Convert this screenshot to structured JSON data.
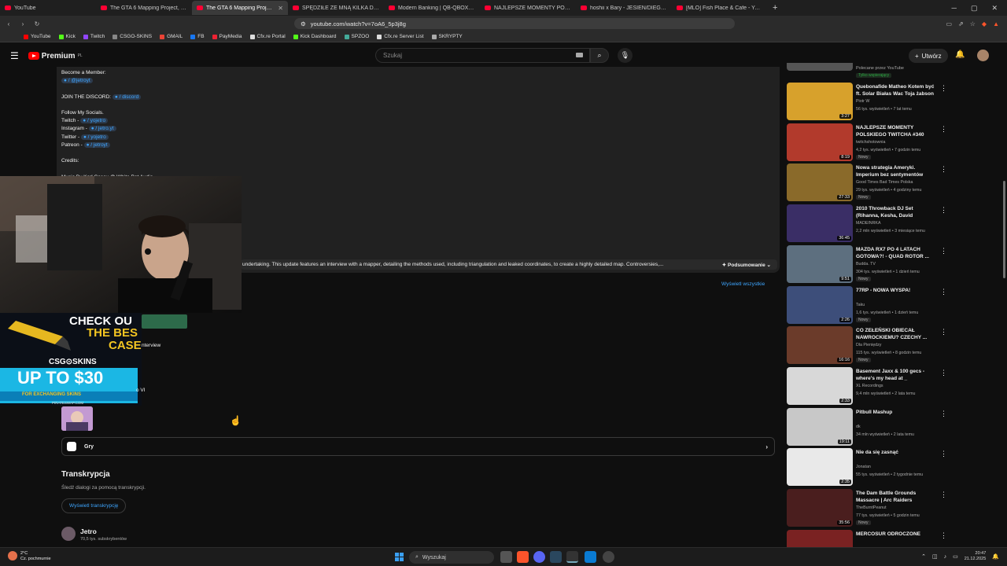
{
  "browser": {
    "tabs": [
      {
        "title": "YouTube",
        "active": false
      },
      {
        "title": "The GTA 6 Mapping Project, 2 Years i",
        "active": false
      },
      {
        "title": "The GTA 6 Mapping Project, 2 Y",
        "active": true
      },
      {
        "title": "SPĘDZIŁE ZE MNĄ KILKA DNI - YouTu",
        "active": false
      },
      {
        "title": "Modern Banking | QB-QBOX-ESX | Fi",
        "active": false
      },
      {
        "title": "NAJLEPSZE MOMENTY POLSKIEGO T",
        "active": false
      },
      {
        "title": "hoshii x Bary - JESIEŃ/DIEGO (hoshi",
        "active": false
      },
      {
        "title": "[MLO] Fish Place & Cafe - YouTube",
        "active": false
      }
    ],
    "url": "youtube.com/watch?v=7oA6_5p3j8g",
    "bookmarks": [
      "YouTube",
      "Kick",
      "Twitch",
      "CSGO-SKINS",
      "GMAIL",
      "FB",
      "PayMedia",
      "Cfx.re Portal",
      "Kick Dashboard",
      "SPZOO",
      "Cfx.re Server List",
      "SKRYPTY"
    ]
  },
  "header": {
    "logo": "Premium",
    "logo_region": "PL",
    "search_placeholder": "Szukaj",
    "create_label": "Utwórz"
  },
  "description": {
    "become_member": "Become a Member:",
    "member_link": "/ @jetroyt",
    "discord_prefix": "JOIN THE DISCORD:",
    "discord_link": "/ discord",
    "follow": "Follow My Socials.",
    "socials": [
      {
        "name": "Twitch -",
        "link": "/ yojetro"
      },
      {
        "name": "Instagram -",
        "link": "/ jetro.yt"
      },
      {
        "name": "Twitter -",
        "link": "/ yojetro"
      },
      {
        "name": "Patreon -",
        "link": "/ jetroyt"
      }
    ],
    "credits": "Credits:",
    "music": "Music By Karl Casey @ White Bat Audio",
    "summary_text": "undertaking. This update features an interview with a mapper, detailing the methods used, including triangulation and leaked coordinates, to create a highly detailed map. Controversies,...",
    "summary_btn": "Podsumowanie",
    "view_all": "Wyświetl wszystkie",
    "chapter1": "nterview",
    "chapter2": "o VI"
  },
  "ad": {
    "line1": "CHECK OU",
    "line2": "THE BES",
    "line3": "CASE",
    "brand": "CSG⊙SKINS",
    "offer": "UP TO $30",
    "offer_sub": "FOR EXCHANGING SKINS",
    "site": "PIRATESWAP.COM"
  },
  "category": {
    "label": "Gry"
  },
  "transcript": {
    "title": "Transkrypcja",
    "subtitle": "Śledź dialogi za pomocą transkrypcji.",
    "button": "Wyświetl transkrypcję"
  },
  "channel": {
    "name": "Jetro",
    "subs": "70,5 tys. subskrybentów"
  },
  "sidebar": {
    "top_text": "Polecane przez YouTube",
    "top_badge": "Tylko wspierający",
    "items": [
      {
        "title": "Quebonafide Matheo Kotem być ft. Solar Białas Wac Toja żabson",
        "channel": "Piotr W",
        "meta": "56 tys. wyświetleń • 7 lat temu",
        "duration": "3:27",
        "badge": ""
      },
      {
        "title": "NAJLEPSZE MOMENTY POLSKIEGO TWITCHA #340",
        "channel": "twitchshotownia",
        "meta": "4,2 tys. wyświetleń • 7 godzin temu",
        "duration": "8:19",
        "badge": "Nowy"
      },
      {
        "title": "Nowa strategia Ameryki. Imperium bez sentymentów",
        "channel": "Good Times Bad Times Polska",
        "meta": "29 tys. wyświetleń • 4 godziny temu",
        "duration": "27:33",
        "badge": "Nowy"
      },
      {
        "title": "2010 Throwback DJ Set (Rihanna, Kesha, David Guetta,...",
        "channel": "MADEINRKA",
        "meta": "2,2 mln wyświetleń • 3 miesiące temu",
        "duration": "36:45",
        "badge": ""
      },
      {
        "title": "MAZDA RX7 PO 4 LATACH GOTOWA?! - QUAD ROTOR ...",
        "channel": "Budda. TV",
        "meta": "304 tys. wyświetleń • 1 dzień temu",
        "duration": "9:51",
        "badge": "Nowy"
      },
      {
        "title": "77RP - NOWA WYSPA!",
        "channel": "Taku",
        "meta": "1,6 tys. wyświetleń • 1 dzień temu",
        "duration": "2:26",
        "badge": "Nowy"
      },
      {
        "title": "CO ZEŁEŃSKI OBIECAŁ NAWROCKIEMU? CZECHY ...",
        "channel": "Dla Pieniędzy",
        "meta": "115 tys. wyświetleń • 8 godzin temu",
        "duration": "16:16",
        "badge": "Nowy"
      },
      {
        "title": "Basement Jaxx & 100 gecs - where's my head at _",
        "channel": "XL Recordings",
        "meta": "9,4 mln wyświetleń • 2 lata temu",
        "duration": "2:33",
        "badge": ""
      },
      {
        "title": "Pitbull Mashup",
        "channel": "dk",
        "meta": "34 mln wyświetleń • 2 lata temu",
        "duration": "19:11",
        "badge": ""
      },
      {
        "title": "Nie da się zasnąć",
        "channel": "Jonatan",
        "meta": "55 tys. wyświetleń • 2 tygodnie temu",
        "duration": "2:35",
        "badge": ""
      },
      {
        "title": "The Dam Battle Grounds Massacre | Arc Raiders",
        "channel": "TheBurntPeanut",
        "meta": "77 tys. wyświetleń • 5 godzin temu",
        "duration": "35:56",
        "badge": "Nowy"
      },
      {
        "title": "MERCOSUR ODROCZONE",
        "channel": "",
        "meta": "",
        "duration": "",
        "badge": ""
      }
    ]
  },
  "taskbar": {
    "temp": "2°C",
    "weather": "Cz. pochmurnie",
    "search": "Wyszukaj",
    "time": "20:47",
    "date": "21.12.2025"
  }
}
